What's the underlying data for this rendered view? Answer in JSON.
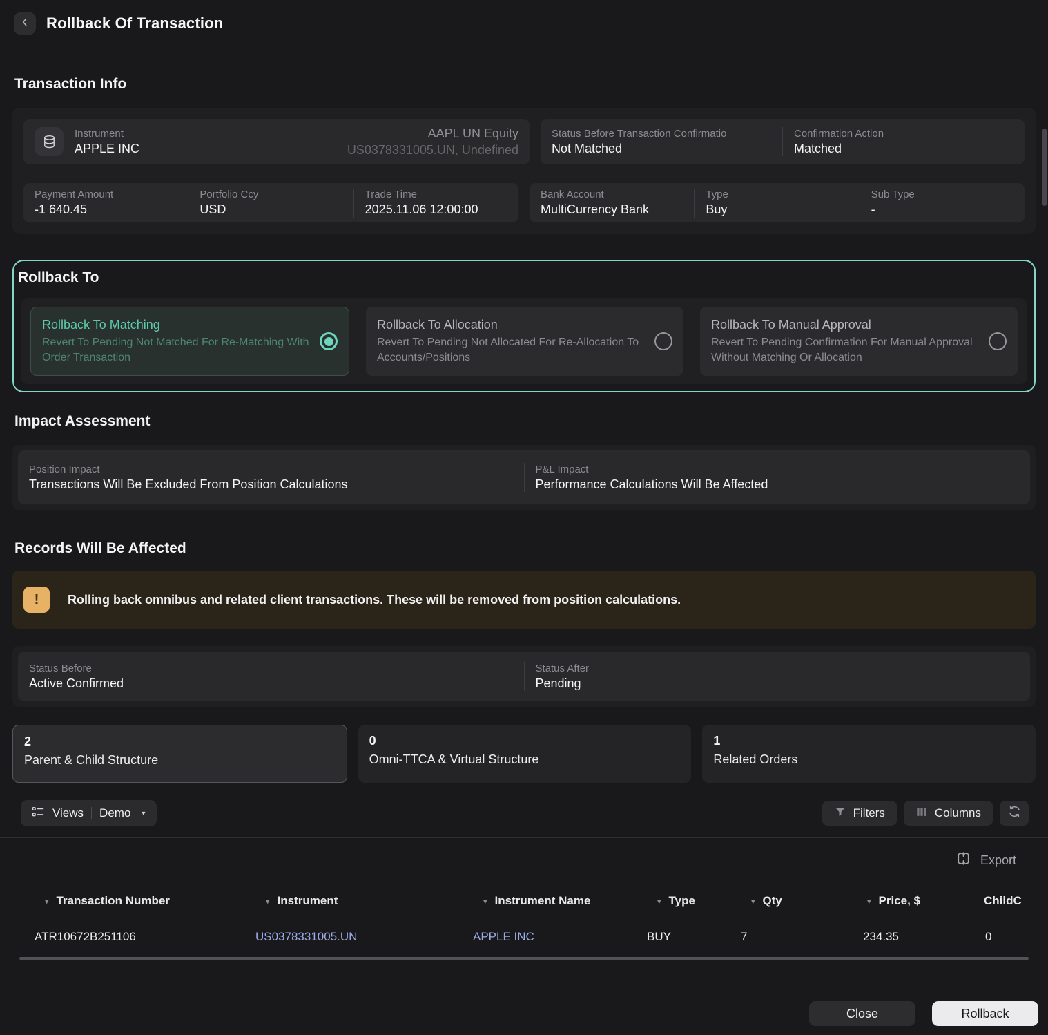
{
  "header": {
    "title": "Rollback Of Transaction"
  },
  "icons": {
    "sort_caret": "▾",
    "dropdown_caret": "▼",
    "warning_glyph": "!"
  },
  "transaction_info": {
    "heading": "Transaction Info",
    "instrument_label": "Instrument",
    "instrument_value": "APPLE INC",
    "instrument_ticker": "AAPL UN Equity",
    "instrument_isin": "US0378331005.UN, Undefined",
    "status_before_confirmation_label": "Status Before Transaction Confirmatio",
    "status_before_confirmation_value": "Not Matched",
    "confirmation_action_label": "Confirmation Action",
    "confirmation_action_value": "Matched",
    "payment_amount_label": "Payment Amount",
    "payment_amount_value": "-1 640.45",
    "portfolio_ccy_label": "Portfolio Ccy",
    "portfolio_ccy_value": "USD",
    "trade_time_label": "Trade Time",
    "trade_time_value": "2025.11.06 12:00:00",
    "bank_account_label": "Bank Account",
    "bank_account_value": "MultiCurrency Bank",
    "type_label": "Type",
    "type_value": "Buy",
    "sub_type_label": "Sub Type",
    "sub_type_value": "-"
  },
  "rollback_to": {
    "heading": "Rollback To",
    "options": [
      {
        "title": "Rollback To Matching",
        "description": "Revert To Pending Not Matched For Re-Matching With Order Transaction",
        "selected": true
      },
      {
        "title": "Rollback To Allocation",
        "description": "Revert To Pending Not Allocated For Re-Allocation To Accounts/Positions",
        "selected": false
      },
      {
        "title": "Rollback To Manual Approval",
        "description": "Revert To Pending Confirmation For Manual Approval Without Matching Or Allocation",
        "selected": false
      }
    ]
  },
  "impact": {
    "heading": "Impact Assessment",
    "position_label": "Position Impact",
    "position_value": "Transactions Will Be Excluded From Position Calculations",
    "pnl_label": "P&L Impact",
    "pnl_value": "Performance Calculations Will Be Affected"
  },
  "records": {
    "heading": "Records Will Be Affected",
    "warning_text": "Rolling back omnibus and related client transactions. These will be removed from position calculations.",
    "status_before_label": "Status Before",
    "status_before_value": "Active Confirmed",
    "status_after_label": "Status After",
    "status_after_value": "Pending",
    "tabs": [
      {
        "count": "2",
        "label": "Parent & Child Structure",
        "selected": true
      },
      {
        "count": "0",
        "label": "Omni-TTCA & Virtual Structure",
        "selected": false
      },
      {
        "count": "1",
        "label": "Related Orders",
        "selected": false
      }
    ]
  },
  "toolbar": {
    "views_label": "Views",
    "views_value": "Demo",
    "filters_label": "Filters",
    "columns_label": "Columns",
    "export_label": "Export"
  },
  "table": {
    "headers": [
      "Transaction Number",
      "Instrument",
      "Instrument Name",
      "Type",
      "Qty",
      "Price, $",
      "ChildC"
    ],
    "row": {
      "transaction_number": "ATR10672B251106",
      "instrument": "US0378331005.UN",
      "instrument_name": "APPLE INC",
      "type": "BUY",
      "qty": "7",
      "price": "234.35",
      "child_count": "0"
    }
  },
  "footer": {
    "close_label": "Close",
    "rollback_label": "Rollback"
  },
  "colors": {
    "accent_teal": "#82d6c4",
    "warning_amber": "#e8b266",
    "link_blue": "#9aade8"
  }
}
